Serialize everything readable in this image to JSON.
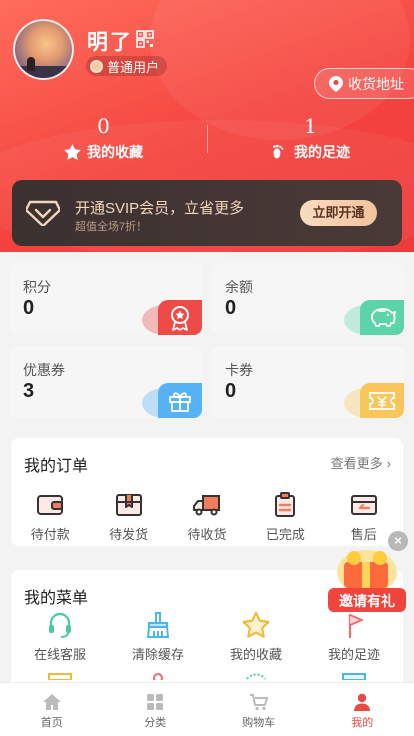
{
  "profile": {
    "username": "明了",
    "level_badge": "普通用户",
    "address_button": "收货地址"
  },
  "stats": {
    "favorites": {
      "count": "0",
      "label": "我的收藏"
    },
    "footprints": {
      "count": "1",
      "label": "我的足迹"
    }
  },
  "vip": {
    "title": "开通SVIP会员，立省更多",
    "subtitle": "超值全场7折！",
    "button": "立即开通"
  },
  "assets": [
    {
      "label": "积分",
      "value": "0",
      "icon": "award-icon",
      "color": "#ee4b48"
    },
    {
      "label": "余额",
      "value": "0",
      "icon": "piggy-bank-icon",
      "color": "#5dd3a9"
    },
    {
      "label": "优惠券",
      "value": "3",
      "icon": "gift-icon",
      "color": "#55b3f5"
    },
    {
      "label": "卡券",
      "value": "0",
      "icon": "ticket-icon",
      "color": "#f8c65b"
    }
  ],
  "orders": {
    "title": "我的订单",
    "more": "查看更多",
    "items": [
      {
        "label": "待付款",
        "icon": "wallet-icon"
      },
      {
        "label": "待发货",
        "icon": "package-icon"
      },
      {
        "label": "待收货",
        "icon": "truck-icon"
      },
      {
        "label": "已完成",
        "icon": "clipboard-icon"
      },
      {
        "label": "售后",
        "icon": "return-icon"
      }
    ]
  },
  "menu": {
    "title": "我的菜单",
    "items": [
      {
        "label": "在线客服",
        "icon": "headset-icon"
      },
      {
        "label": "清除缓存",
        "icon": "broom-icon"
      },
      {
        "label": "我的收藏",
        "icon": "star-icon"
      },
      {
        "label": "我的足迹",
        "icon": "flag-icon"
      }
    ]
  },
  "promo": {
    "text": "邀请有礼"
  },
  "tabbar": [
    {
      "label": "首页",
      "icon": "home-icon"
    },
    {
      "label": "分类",
      "icon": "category-icon"
    },
    {
      "label": "购物车",
      "icon": "cart-icon"
    },
    {
      "label": "我的",
      "icon": "user-icon",
      "active": true
    }
  ],
  "colors": {
    "header_red": "#f4443f",
    "vip_gold": "#f3d6bb",
    "accent": "#e94b42"
  }
}
